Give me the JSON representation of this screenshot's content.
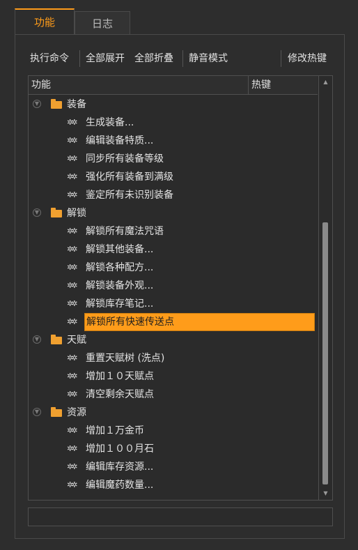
{
  "tabs": [
    {
      "label": "功能",
      "active": true
    },
    {
      "label": "日志",
      "active": false
    }
  ],
  "toolbar": {
    "execute": "执行命令",
    "expand_all": "全部展开",
    "collapse_all": "全部折叠",
    "silent_mode": "静音模式",
    "edit_hotkey": "修改热键"
  },
  "tree": {
    "columns": {
      "function": "功能",
      "hotkey": "热键"
    },
    "categories": [
      {
        "label": "装备",
        "items": [
          {
            "label": "生成装备..."
          },
          {
            "label": "编辑装备特质..."
          },
          {
            "label": "同步所有装备等级"
          },
          {
            "label": "强化所有装备到满级"
          },
          {
            "label": "鉴定所有未识别装备"
          }
        ]
      },
      {
        "label": "解锁",
        "items": [
          {
            "label": "解锁所有魔法咒语"
          },
          {
            "label": "解锁其他装备..."
          },
          {
            "label": "解锁各种配方..."
          },
          {
            "label": "解锁装备外观..."
          },
          {
            "label": "解锁库存笔记..."
          },
          {
            "label": "解锁所有快速传送点",
            "selected": true
          }
        ]
      },
      {
        "label": "天赋",
        "items": [
          {
            "label": "重置天赋树 (洗点)"
          },
          {
            "label": "增加１０天赋点"
          },
          {
            "label": "清空剩余天赋点"
          }
        ]
      },
      {
        "label": "资源",
        "items": [
          {
            "label": "增加１万金币"
          },
          {
            "label": "增加１００月石"
          },
          {
            "label": "编辑库存资源..."
          },
          {
            "label": "编辑魔药数量..."
          }
        ]
      }
    ]
  },
  "colors": {
    "accent": "#ff9c1a",
    "background": "#2d2d2d",
    "folder": "#f0a030"
  },
  "icons": {
    "expander": "collapse-circle-icon",
    "folder": "folder-icon",
    "item": "gears-icon"
  }
}
